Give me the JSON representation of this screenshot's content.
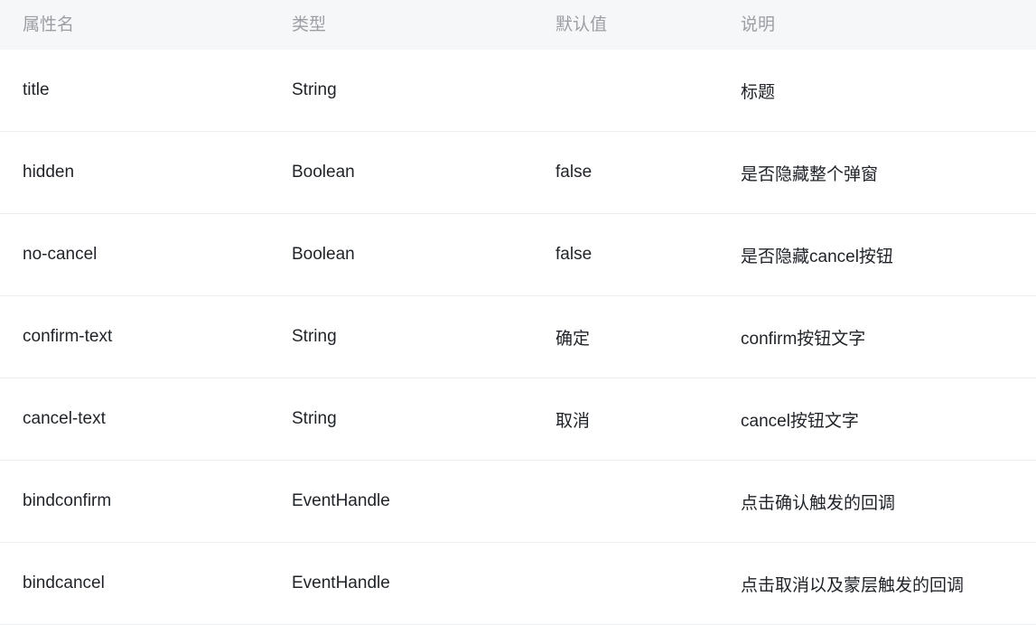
{
  "table": {
    "columns": [
      {
        "key": "name",
        "label": "属性名"
      },
      {
        "key": "type",
        "label": "类型"
      },
      {
        "key": "default",
        "label": "默认值"
      },
      {
        "key": "desc",
        "label": "说明"
      }
    ],
    "rows": [
      {
        "name": "title",
        "type": "String",
        "default": "",
        "desc": "标题"
      },
      {
        "name": "hidden",
        "type": "Boolean",
        "default": "false",
        "desc": "是否隐藏整个弹窗"
      },
      {
        "name": "no-cancel",
        "type": "Boolean",
        "default": "false",
        "desc": "是否隐藏cancel按钮"
      },
      {
        "name": "confirm-text",
        "type": "String",
        "default": "确定",
        "desc": "confirm按钮文字"
      },
      {
        "name": "cancel-text",
        "type": "String",
        "default": "取消",
        "desc": "cancel按钮文字"
      },
      {
        "name": "bindconfirm",
        "type": "EventHandle",
        "default": "",
        "desc": "点击确认触发的回调"
      },
      {
        "name": "bindcancel",
        "type": "EventHandle",
        "default": "",
        "desc": "点击取消以及蒙层触发的回调"
      }
    ]
  },
  "colors": {
    "header_background": "#f6f7f9",
    "header_text": "#9b9ea3",
    "body_text": "#1f2328",
    "row_divider": "#eceef0",
    "page_background": "#ffffff"
  }
}
